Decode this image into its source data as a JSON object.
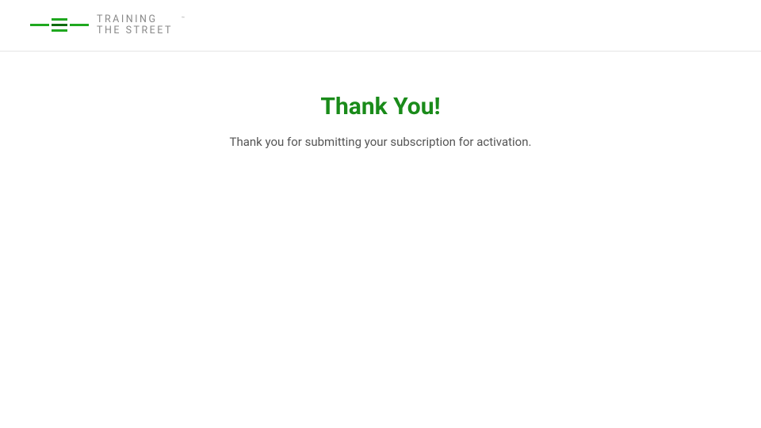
{
  "logo": {
    "line1": "TRAINING",
    "line2": "THE STREET",
    "tm": "™"
  },
  "main": {
    "heading": "Thank You!",
    "subtext": "Thank you for submitting your subscription for activation."
  }
}
